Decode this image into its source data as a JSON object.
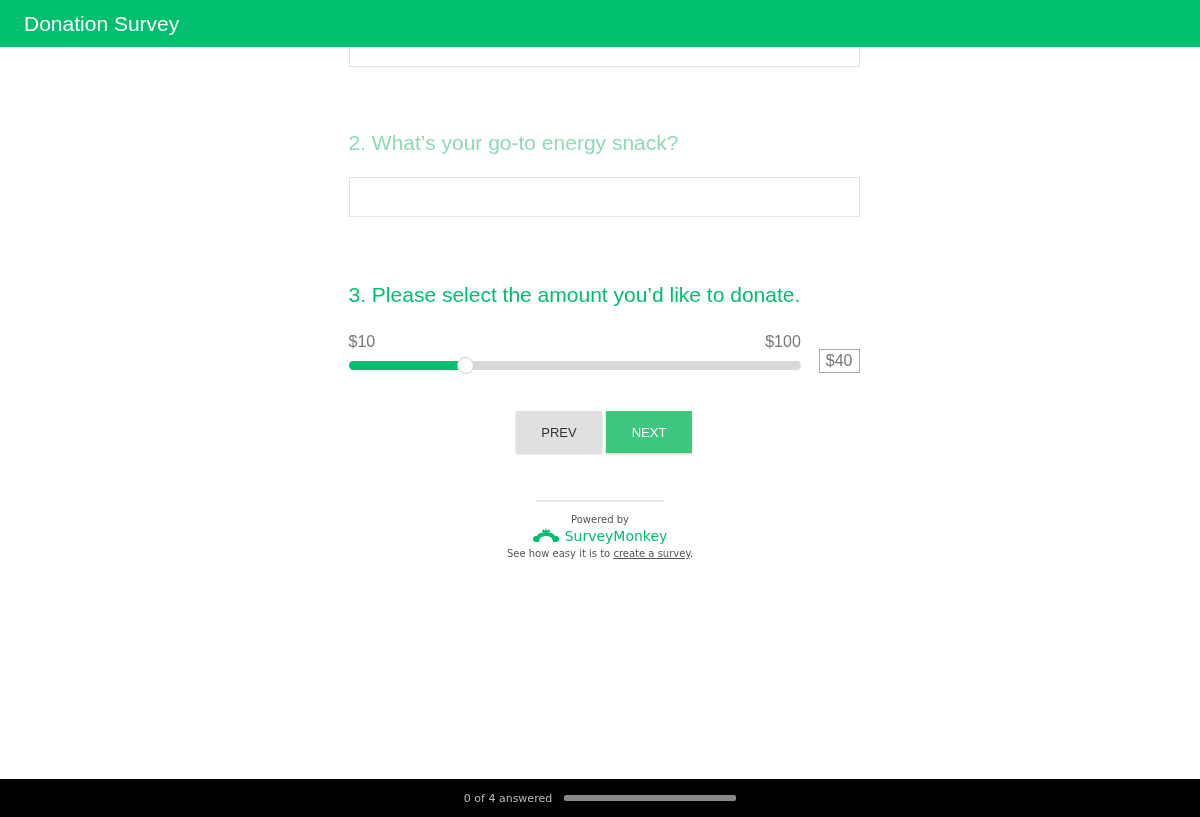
{
  "header": {
    "title": "Donation Survey"
  },
  "questions": [
    {
      "kind": "text"
    },
    {
      "kind": "text",
      "active": false,
      "title": "2. What’s your go-to energy snack?"
    },
    {
      "kind": "slider",
      "active": true,
      "title": "3. Please select the amount you’d like to donate.",
      "min_label": "$10",
      "max_label": "$100",
      "level": 0.26,
      "reading": "$40"
    }
  ],
  "buttons": [
    {
      "label": "PREV",
      "kind": "secondary"
    },
    {
      "label": "NEXT",
      "kind": "primary"
    }
  ],
  "footer": {
    "powered_by": "Powered by",
    "brand": "SurveyMonkey",
    "cta_prefix": "See how easy it is to ",
    "cta_link": "create a survey",
    "cta_suffix": "."
  },
  "progress": {
    "label": "0 of 4 answered",
    "level": 0
  }
}
